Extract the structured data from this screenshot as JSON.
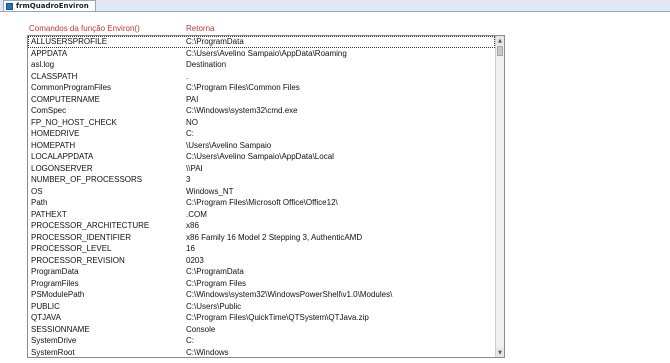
{
  "tab": {
    "title": "frmQuadroEnviron",
    "icon": "form-icon"
  },
  "headers": {
    "command": "Comandos da função Environ()",
    "returns": "Retorna"
  },
  "rows": [
    {
      "name": "ALLUSERSPROFILE",
      "value": "C:\\ProgramData"
    },
    {
      "name": "APPDATA",
      "value": "C:\\Users\\Avelino Sampaio\\AppData\\Roaming"
    },
    {
      "name": "asl.log",
      "value": "Destination"
    },
    {
      "name": "CLASSPATH",
      "value": "."
    },
    {
      "name": "CommonProgramFiles",
      "value": "C:\\Program Files\\Common Files"
    },
    {
      "name": "COMPUTERNAME",
      "value": "PAI"
    },
    {
      "name": "ComSpec",
      "value": "C:\\Windows\\system32\\cmd.exe"
    },
    {
      "name": "FP_NO_HOST_CHECK",
      "value": "NO"
    },
    {
      "name": "HOMEDRIVE",
      "value": "C:"
    },
    {
      "name": "HOMEPATH",
      "value": "\\Users\\Avelino Sampaio"
    },
    {
      "name": "LOCALAPPDATA",
      "value": "C:\\Users\\Avelino Sampaio\\AppData\\Local"
    },
    {
      "name": "LOGONSERVER",
      "value": "\\\\PAI"
    },
    {
      "name": "NUMBER_OF_PROCESSORS",
      "value": "3"
    },
    {
      "name": "OS",
      "value": "Windows_NT"
    },
    {
      "name": "Path",
      "value": "C:\\Program Files\\Microsoft Office\\Office12\\"
    },
    {
      "name": "PATHEXT",
      "value": ".COM"
    },
    {
      "name": "PROCESSOR_ARCHITECTURE",
      "value": "x86"
    },
    {
      "name": "PROCESSOR_IDENTIFIER",
      "value": "x86 Family 16 Model 2 Stepping 3, AuthenticAMD"
    },
    {
      "name": "PROCESSOR_LEVEL",
      "value": "16"
    },
    {
      "name": "PROCESSOR_REVISION",
      "value": "0203"
    },
    {
      "name": "ProgramData",
      "value": "C:\\ProgramData"
    },
    {
      "name": "ProgramFiles",
      "value": "C:\\Program Files"
    },
    {
      "name": "PSModulePath",
      "value": "C:\\Windows\\system32\\WindowsPowerShell\\v1.0\\Modules\\"
    },
    {
      "name": "PUBLIC",
      "value": "C:\\Users\\Public"
    },
    {
      "name": "QTJAVA",
      "value": "C:\\Program Files\\QuickTime\\QTSystem\\QTJava.zip"
    },
    {
      "name": "SESSIONNAME",
      "value": "Console"
    },
    {
      "name": "SystemDrive",
      "value": "C:"
    },
    {
      "name": "SystemRoot",
      "value": "C:\\Windows"
    }
  ],
  "scrollbar": {
    "up_icon": "▲",
    "down_icon": "▼"
  }
}
